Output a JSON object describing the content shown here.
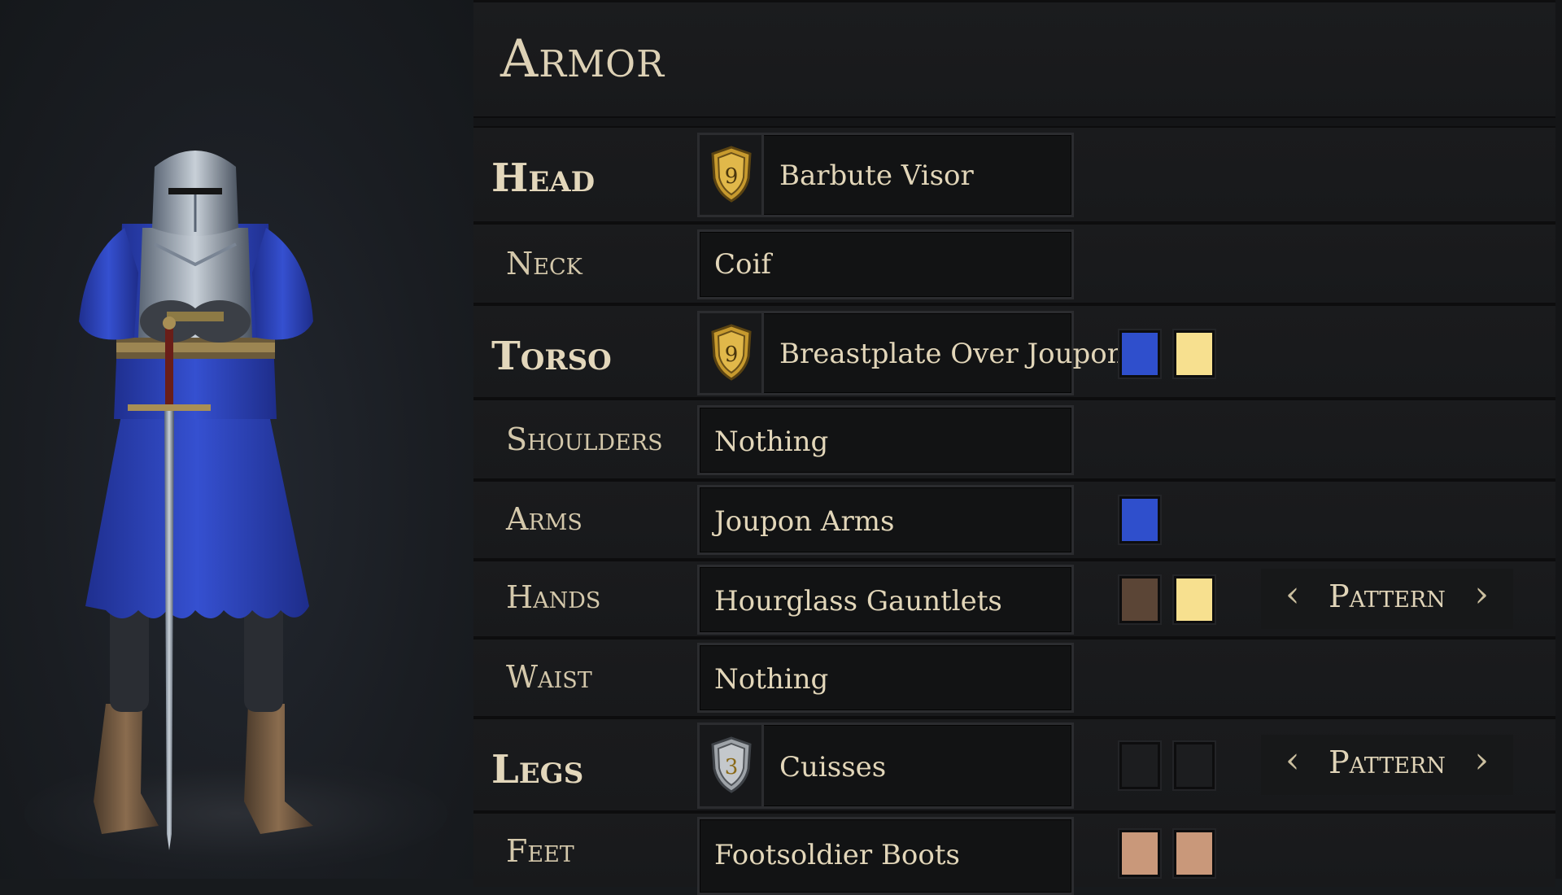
{
  "panel": {
    "title": "Armor"
  },
  "slots": [
    {
      "label": "Head",
      "item": "Barbute Visor",
      "tier": "9",
      "tier_color": "gold",
      "swatches": [],
      "pattern_label": ""
    },
    {
      "label": "Neck",
      "item": "Coif",
      "swatches": []
    },
    {
      "label": "Torso",
      "item": "Breastplate Over Joupon",
      "tier": "9",
      "tier_color": "gold",
      "swatches": [
        "#2f4fcc",
        "#f7e08f"
      ]
    },
    {
      "label": "Shoulders",
      "item": "Nothing",
      "swatches": []
    },
    {
      "label": "Arms",
      "item": "Joupon Arms",
      "swatches": [
        "#2f4fcc"
      ]
    },
    {
      "label": "Hands",
      "item": "Hourglass Gauntlets",
      "swatches": [
        "#5b4536",
        "#f7e08f"
      ],
      "pattern_label": "Pattern"
    },
    {
      "label": "Waist",
      "item": "Nothing",
      "swatches": []
    },
    {
      "label": "Legs",
      "item": "Cuisses",
      "tier": "3",
      "tier_color": "silver",
      "swatches": [
        "#1c1d1f",
        "#1c1d1f"
      ],
      "pattern_label": "Pattern"
    },
    {
      "label": "Feet",
      "item": "Footsoldier Boots",
      "swatches": [
        "#c9987a",
        "#c9987a"
      ]
    }
  ],
  "arrows": {
    "left": "‹",
    "right": "›"
  },
  "colors": {
    "accent_text": "#e3d7bb",
    "tier_gold": "#c79a2e",
    "tier_silver": "#9ea3a8",
    "knight_blue": "#2d43b8"
  }
}
